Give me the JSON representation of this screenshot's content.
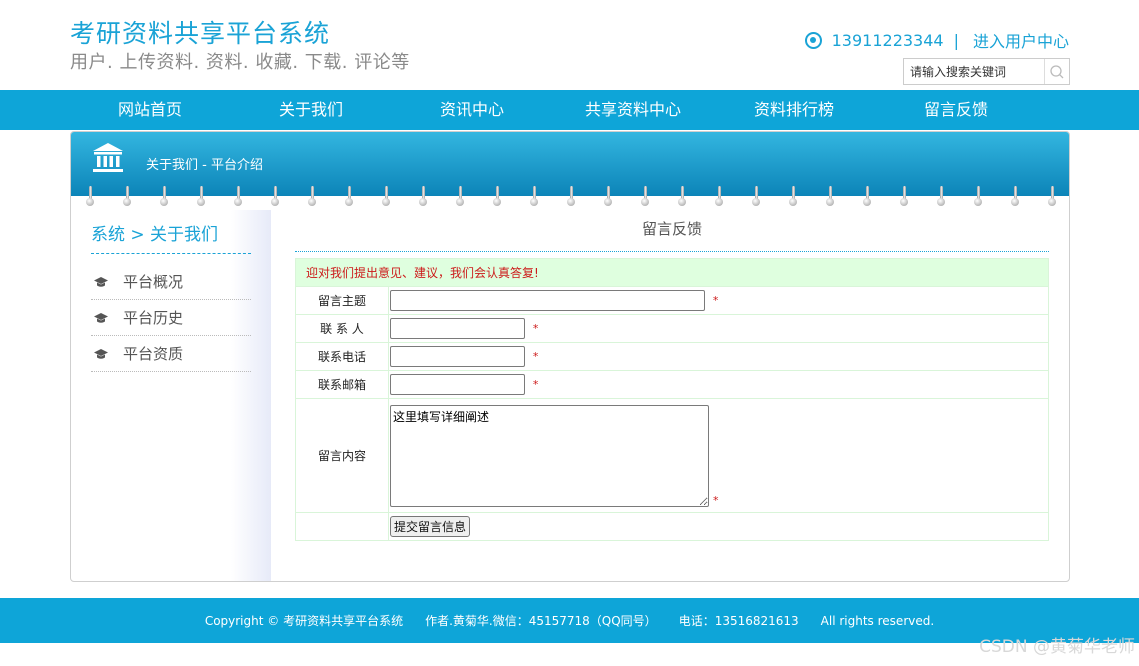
{
  "header": {
    "title": "考研资料共享平台系统",
    "subtitle": "用户. 上传资料. 资料. 收藏. 下载. 评论等",
    "phone": "13911223344",
    "separator": "|",
    "user_center": "进入用户中心",
    "search_placeholder": "请输入搜索关键词"
  },
  "nav": {
    "items": [
      "网站首页",
      "关于我们",
      "资讯中心",
      "共享资料中心",
      "资料排行榜",
      "留言反馈"
    ]
  },
  "banner": {
    "label": "关于我们 - 平台介绍"
  },
  "sidebar": {
    "breadcrumb": "系统 > 关于我们",
    "items": [
      "平台概况",
      "平台历史",
      "平台资质"
    ]
  },
  "content": {
    "title": "留言反馈",
    "notice": "迎对我们提出意见、建议，我们会认真答复!",
    "fields": {
      "subject_label": "留言主题",
      "contact_label": "联 系 人",
      "phone_label": "联系电话",
      "email_label": "联系邮箱",
      "message_label": "留言内容",
      "message_value": "这里填写详细阐述",
      "required_mark": "*"
    },
    "submit_label": "提交留言信息"
  },
  "footer": {
    "copyright": "Copyright © 考研资料共享平台系统",
    "author": "作者.黄菊华.微信：45157718（QQ同号）",
    "phone": "电话：13516821613",
    "rights": "All rights reserved."
  },
  "watermark": "CSDN @黄菊华老师",
  "colors": {
    "brand": "#0ea5d8",
    "accent_text": "#1aa3d6",
    "required": "#cc1a1a",
    "notice_bg": "#dfffdf"
  }
}
